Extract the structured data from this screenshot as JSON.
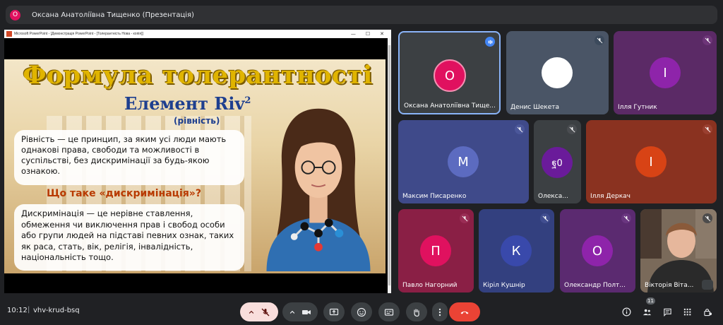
{
  "topbar": {
    "avatar_letter": "О",
    "title": "Оксана Анатоліївна Тищенко (Презентація)"
  },
  "presentation": {
    "window_title": "Microsoft PowerPoint - [Демонстрація PowerPoint - [Толерантність Нова - копія]]",
    "slide": {
      "title": "Формула толерантності",
      "subtitle": "Елемент Riv",
      "subtitle_sup": "2",
      "subtitle2": "(рівність)",
      "box1_text": "Рівність — це принцип, за яким усі люди мають однакові права, свободи та можливості в суспільстві, без дискримінації за будь-якою ознакою.",
      "question": "Що таке «дискримінація»?",
      "box2_text": "Дискримінація — це нерівне ставлення, обмеження чи виключення прав і свобод особи або групи людей на підставі певних ознак, таких як раса, стать, вік, релігія, інвалідність, національність тощо."
    }
  },
  "participants": [
    {
      "name": "Оксана Анатоліївна Тище...",
      "letter": "О",
      "avatar_color": "#e0115f",
      "tile_color": "#3c4043"
    },
    {
      "name": "Денис Шекета",
      "letter": "",
      "avatar_color": "#ffffff",
      "tile_color": "#4a5566"
    },
    {
      "name": "Ілля Гутник",
      "letter": "І",
      "avatar_color": "#8e24aa",
      "tile_color": "#5b2a66"
    },
    {
      "name": "Максим Писаренко",
      "letter": "М",
      "avatar_color": "#5c6bc0",
      "tile_color": "#3f4a8a"
    },
    {
      "name": "Олекса...",
      "letter": "",
      "avatar_color": "#6a1b9a",
      "tile_color": "#3c4043"
    },
    {
      "name": "Ілля Деркач",
      "letter": "І",
      "avatar_color": "#d84315",
      "tile_color": "#8a3220"
    },
    {
      "name": "Павло Нагорний",
      "letter": "П",
      "avatar_color": "#e0115f",
      "tile_color": "#8a1f45"
    },
    {
      "name": "Кіріл Кушнір",
      "letter": "К",
      "avatar_color": "#3949ab",
      "tile_color": "#33407f"
    },
    {
      "name": "Олександр Полт...",
      "letter": "О",
      "avatar_color": "#8e24aa",
      "tile_color": "#5b2a70"
    },
    {
      "name": "Вікторія Віта...",
      "letter": "",
      "avatar_color": "#cccccc",
      "tile_color": "#5a4a3f"
    }
  ],
  "bottom": {
    "time": "10:12",
    "separator": "|",
    "meeting_code": "vhv-krud-bsq",
    "participant_count": "11"
  },
  "colors": {
    "background": "#202124",
    "end_call": "#ea4335",
    "mic_off": "#f9dedc"
  }
}
